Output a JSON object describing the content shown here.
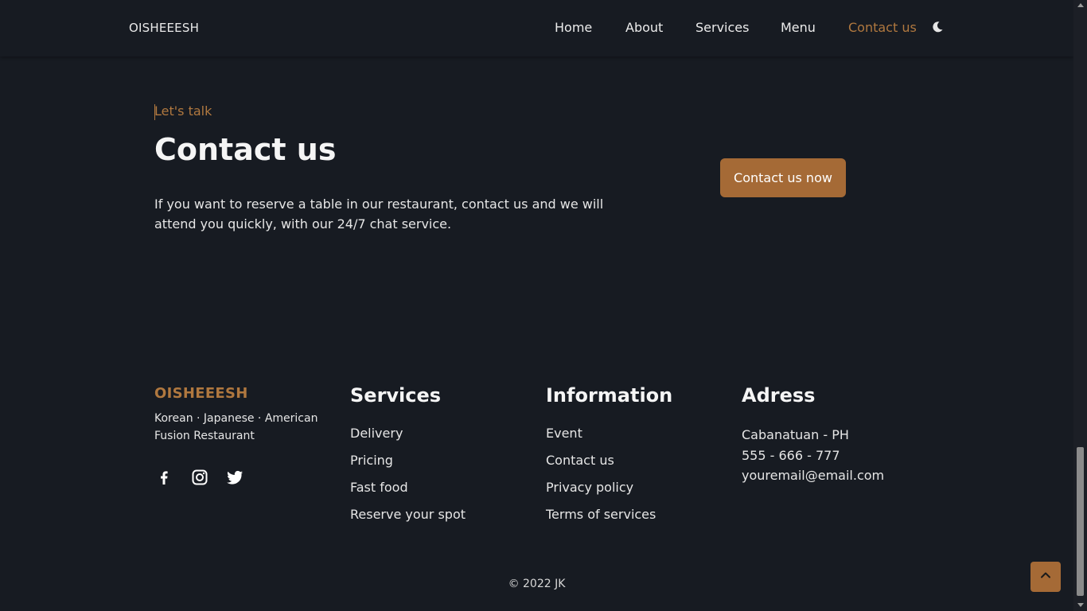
{
  "header": {
    "logo": "OISHEEESH",
    "nav": [
      {
        "label": "Home"
      },
      {
        "label": "About"
      },
      {
        "label": "Services"
      },
      {
        "label": "Menu"
      },
      {
        "label": "Contact us",
        "active": true
      }
    ],
    "theme_icon": "moon-icon"
  },
  "contact": {
    "kicker": "Let's talk",
    "title": "Contact us",
    "description": "If you want to reserve a table in our restaurant, contact us and we will attend you quickly, with our 24/7 chat service.",
    "cta_label": "Contact us now"
  },
  "footer": {
    "brand": "OISHEEESH",
    "tagline": "Korean · Japanese · American Fusion Restaurant",
    "social_icons": [
      "facebook-icon",
      "instagram-icon",
      "twitter-icon"
    ],
    "services": {
      "title": "Services",
      "items": [
        "Delivery",
        "Pricing",
        "Fast food",
        "Reserve your spot"
      ]
    },
    "information": {
      "title": "Information",
      "items": [
        "Event",
        "Contact us",
        "Privacy policy",
        "Terms of services"
      ]
    },
    "address": {
      "title": "Adress",
      "lines": [
        "Cabanatuan - PH",
        "555 - 666 - 777",
        "youremail@email.com"
      ]
    },
    "copyright": "© 2022 JK",
    "scroll_top_icon": "chevron-up-icon"
  },
  "colors": {
    "background": "#171b22",
    "accent": "#b0783f",
    "button": "#a56a36",
    "text": "#f3f3f3"
  }
}
